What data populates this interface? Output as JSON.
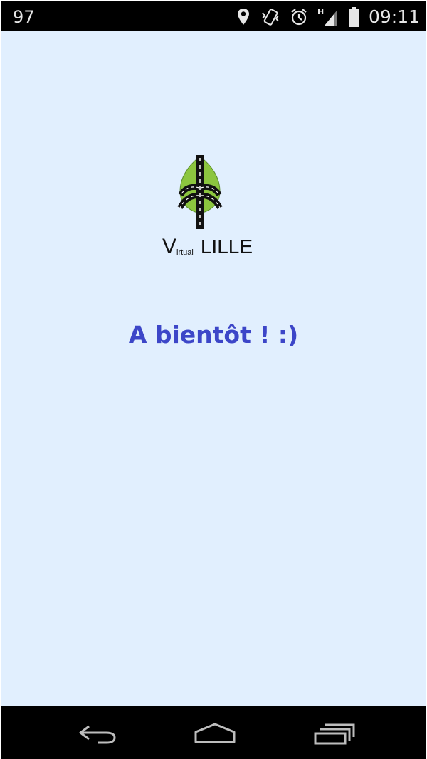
{
  "status_bar": {
    "left_text": "97",
    "time": "09:11",
    "icons": [
      "location-pin-icon",
      "vibrate-icon",
      "alarm-icon",
      "signal-h-icon",
      "battery-icon"
    ],
    "signal_label": "H"
  },
  "logo": {
    "letter_v": "V",
    "small_text": "irtual",
    "city": "LILLE",
    "leaf_color": "#8cc63f"
  },
  "message": {
    "text": "A bientôt ! :)",
    "color": "#3c46c8"
  },
  "nav_bar": {
    "icons": [
      "back-icon",
      "home-icon",
      "recent-apps-icon"
    ]
  }
}
